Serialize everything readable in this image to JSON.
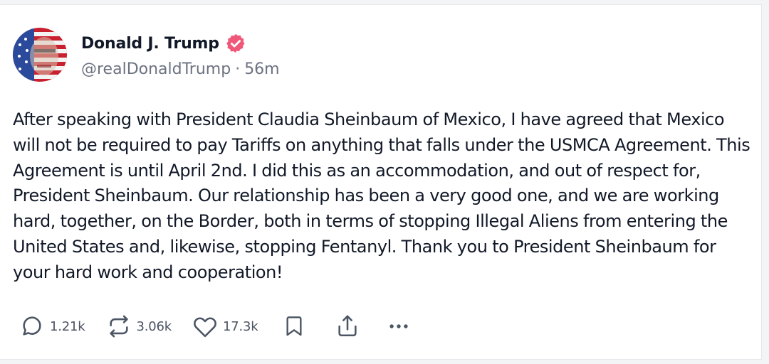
{
  "post": {
    "author": {
      "display_name": "Donald J. Trump",
      "handle": "@realDonaldTrump",
      "timestamp": "56m",
      "separator": "·",
      "verified_icon": "verified-badge-icon",
      "verified_color": "#f0587a"
    },
    "body": "After speaking with President Claudia Sheinbaum of Mexico, I have agreed that Mexico will not be required to pay Tariffs on anything that falls under the USMCA Agreement. This Agreement is until April 2nd. I did this as an accommodation, and out of respect for, President Sheinbaum. Our relationship has been a very good one, and we are working hard, together, on the Border, both in terms of stopping Illegal Aliens from entering the United States and, likewise, stopping Fentanyl. Thank you to President Sheinbaum for your hard work and cooperation!",
    "actions": {
      "replies": {
        "icon": "comment-icon",
        "count": "1.21k"
      },
      "retruths": {
        "icon": "repost-icon",
        "count": "3.06k"
      },
      "likes": {
        "icon": "heart-icon",
        "count": "17.3k"
      },
      "bookmark": {
        "icon": "bookmark-icon"
      },
      "share": {
        "icon": "share-icon"
      },
      "more": {
        "icon": "more-icon"
      }
    }
  },
  "colors": {
    "text_primary": "#111827",
    "text_secondary": "#6b7280",
    "icon": "#4b5563",
    "verified": "#f0587a"
  }
}
